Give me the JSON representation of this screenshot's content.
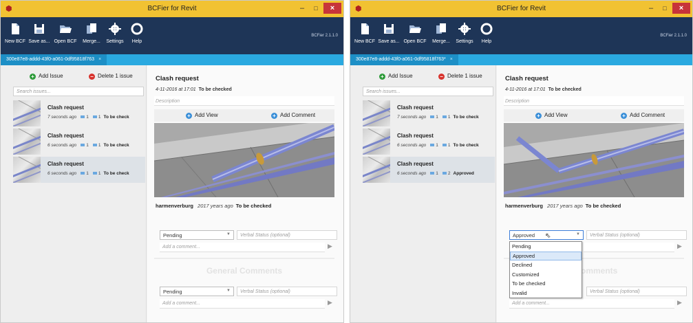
{
  "window": {
    "title": "BCFier for Revit",
    "version": "BCFier 2.1.1.0",
    "minimize": "–",
    "maximize": "□",
    "close": "×"
  },
  "toolbar": {
    "new_bcf": "New BCF",
    "save_as": "Save as...",
    "open_bcf": "Open BCF",
    "merge": "Merge...",
    "settings": "Settings",
    "help": "Help"
  },
  "colors": {
    "titlebar": "#f1c232",
    "toolbar": "#1e3557",
    "tab": "#2aa9e0",
    "close": "#c7343a"
  },
  "left_window": {
    "tab_label": "300e87e8-addd-43f0-a061-0df95818f763",
    "add_issue": "Add Issue",
    "delete_issue": "Delete 1 issue",
    "search_placeholder": "Search issues...",
    "issues": [
      {
        "title": "Clash request",
        "age": "7 seconds ago",
        "views": "1",
        "comments": "1",
        "status": "To be check"
      },
      {
        "title": "Clash request",
        "age": "6 seconds ago",
        "views": "1",
        "comments": "1",
        "status": "To be check"
      },
      {
        "title": "Clash request",
        "age": "6 seconds ago",
        "views": "1",
        "comments": "1",
        "status": "To be check"
      }
    ],
    "detail": {
      "title": "Clash request",
      "date": "4-11-2016 at 17:01",
      "status": "To be checked",
      "description_placeholder": "Description",
      "add_view": "Add View",
      "add_comment": "Add Comment",
      "author": "harmenverburg",
      "author_age": "2017 years ago",
      "author_status": "To be checked",
      "status_select": "Pending",
      "verbal_placeholder": "Verbal Status (optional)",
      "comment_placeholder": "Add a comment...",
      "general_comments": "General Comments",
      "gc_status_select": "Pending",
      "gc_verbal_placeholder": "Verbal Status (optional)",
      "gc_comment_placeholder": "Add a comment..."
    }
  },
  "right_window": {
    "tab_label": "300e87e8-addd-43f0-a061-0df95818f763*",
    "add_issue": "Add Issue",
    "delete_issue": "Delete 1 issue",
    "search_placeholder": "Search issues...",
    "issues": [
      {
        "title": "Clash request",
        "age": "7 seconds ago",
        "views": "1",
        "comments": "1",
        "status": "To be check"
      },
      {
        "title": "Clash request",
        "age": "6 seconds ago",
        "views": "1",
        "comments": "1",
        "status": "To be check"
      },
      {
        "title": "Clash request",
        "age": "6 seconds ago",
        "views": "1",
        "comments": "2",
        "status": "Approved"
      }
    ],
    "detail": {
      "title": "Clash request",
      "date": "4-11-2016 at 17:01",
      "status": "To be checked",
      "description_placeholder": "Description",
      "add_view": "Add View",
      "add_comment": "Add Comment",
      "author": "harmenverburg",
      "author_age": "2017 years ago",
      "author_status": "To be checked",
      "status_select": "Approved",
      "verbal_placeholder": "Verbal Status (optional)",
      "comment_placeholder": "Add a comment...",
      "general_comments": "l Comments",
      "gc_verbal_placeholder": "Verbal Status (optional)",
      "gc_comment_placeholder": "Add a comment...",
      "dropdown_options": [
        "Pending",
        "Approved",
        "Declined",
        "Customized",
        "To be checked",
        "Invalid"
      ],
      "dropdown_highlighted": "Approved"
    }
  }
}
